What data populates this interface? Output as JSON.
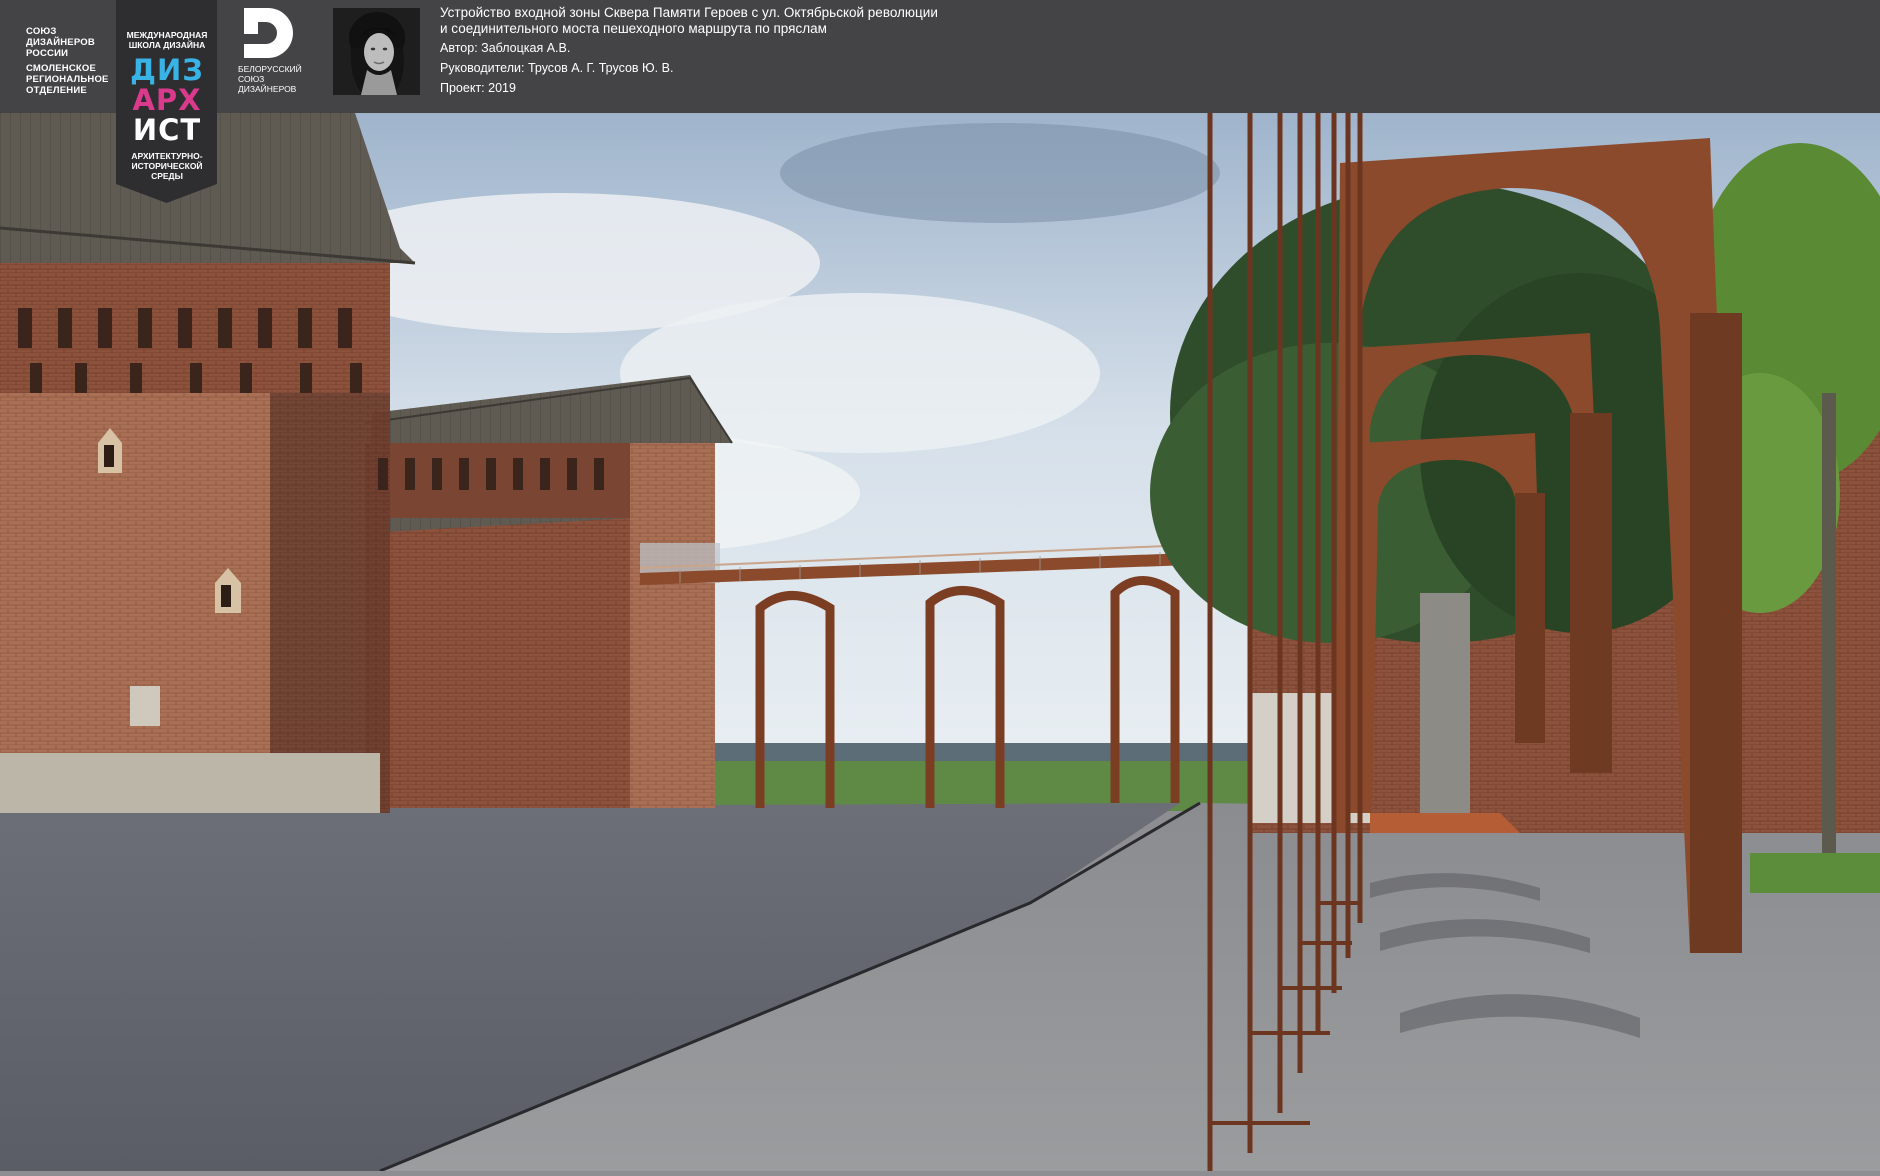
{
  "header": {
    "org_lines": [
      "Союз",
      "дизайнеров",
      "России",
      "Смоленское",
      "региональное",
      "отделение"
    ],
    "school_badge": {
      "top_lines": [
        "Международная",
        "школа дизайна"
      ],
      "word_lines": [
        "ДИЗ",
        "АРХ",
        "ИСТ"
      ],
      "word_colors": [
        "#39b2e5",
        "#d93a8c",
        "#ffffff"
      ],
      "bottom_lines": [
        "Архитектурно-",
        "исторической",
        "среды"
      ]
    },
    "partner_logo": {
      "icon": "belarusian-designers-union-logo",
      "lines": [
        "Белорусский",
        "союз",
        "дизайнеров"
      ]
    },
    "author_photo": "author-portrait",
    "title_lines": [
      "Устройство входной зоны Сквера Памяти Героев с ул. Октябрьской революции",
      "и соединительного моста пешеходного маршрута по пряслам"
    ],
    "author": "Автор: Заблоцкая А.В.",
    "supervisors": "Руководители: Трусов А. Г. Трусов Ю. В.",
    "project": "Проект: 2019"
  },
  "scene": {
    "description_icon": "render-visualization",
    "colors": {
      "sky": "#c9d7e6",
      "brick": "#8a4f3a",
      "roof": "#5f5a52",
      "corten": "#8c4a2c",
      "pavement": "#6f7178",
      "grass": "#5e8a45",
      "foliage": "#2f4d2b"
    }
  }
}
